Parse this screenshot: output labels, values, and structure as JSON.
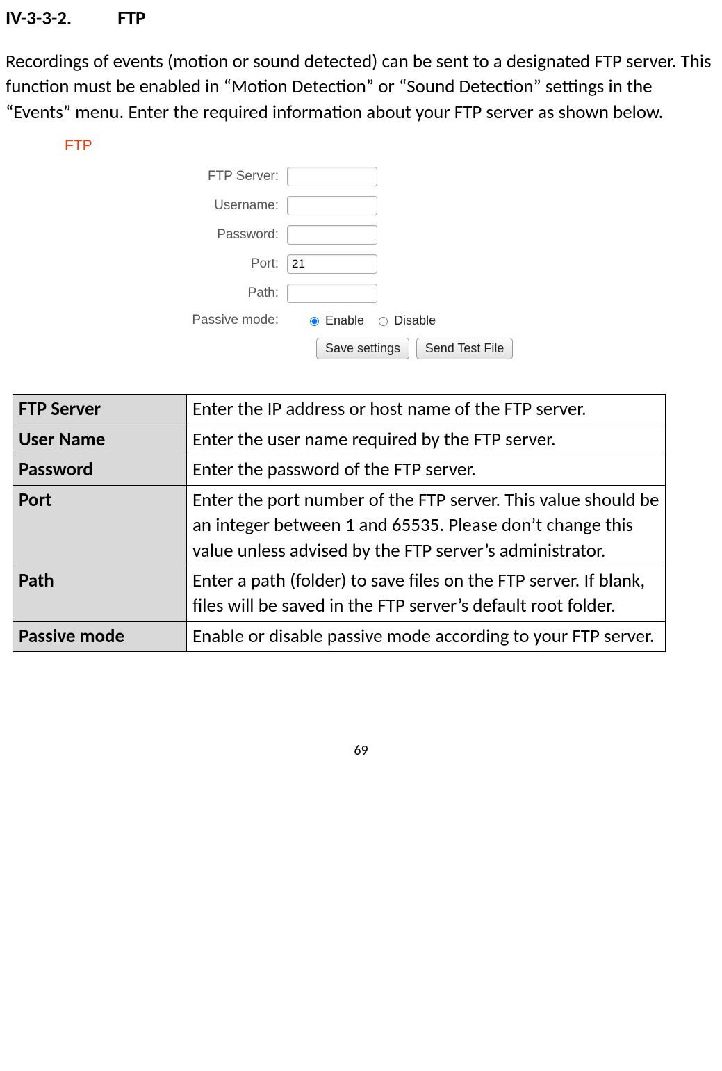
{
  "section": {
    "number": "IV-3-3-2.",
    "title": "FTP"
  },
  "intro": "Recordings of events (motion or sound detected) can be sent to a designated FTP server. This function must be enabled in “Motion Detection” or “Sound Detection” settings in the “Events” menu. Enter the required information about your FTP server as shown below.",
  "form": {
    "title": "FTP",
    "fields": {
      "ftp_server": {
        "label": "FTP Server:",
        "value": ""
      },
      "username": {
        "label": "Username:",
        "value": ""
      },
      "password": {
        "label": "Password:",
        "value": ""
      },
      "port": {
        "label": "Port:",
        "value": "21"
      },
      "path": {
        "label": "Path:",
        "value": ""
      },
      "passive": {
        "label": "Passive mode:",
        "enable": "Enable",
        "disable": "Disable",
        "selected": "enable"
      }
    },
    "buttons": {
      "save": "Save settings",
      "test": "Send Test File"
    }
  },
  "table": [
    {
      "label": "FTP Server",
      "desc": "Enter the IP address or host name of the FTP server."
    },
    {
      "label": "User Name",
      "desc": "Enter the user name required by the FTP server."
    },
    {
      "label": "Password",
      "desc": "Enter the password of the FTP server."
    },
    {
      "label": "Port",
      "desc": "Enter the port number of the FTP server. This value should be an integer between 1 and 65535. Please don’t change this value unless advised by the FTP server’s administrator."
    },
    {
      "label": "Path",
      "desc": "Enter a path (folder) to save files on the FTP server. If blank, files will be saved in the FTP server’s default root folder."
    },
    {
      "label": "Passive mode",
      "desc": "Enable or disable passive mode according to your FTP server."
    }
  ],
  "page_number": "69"
}
